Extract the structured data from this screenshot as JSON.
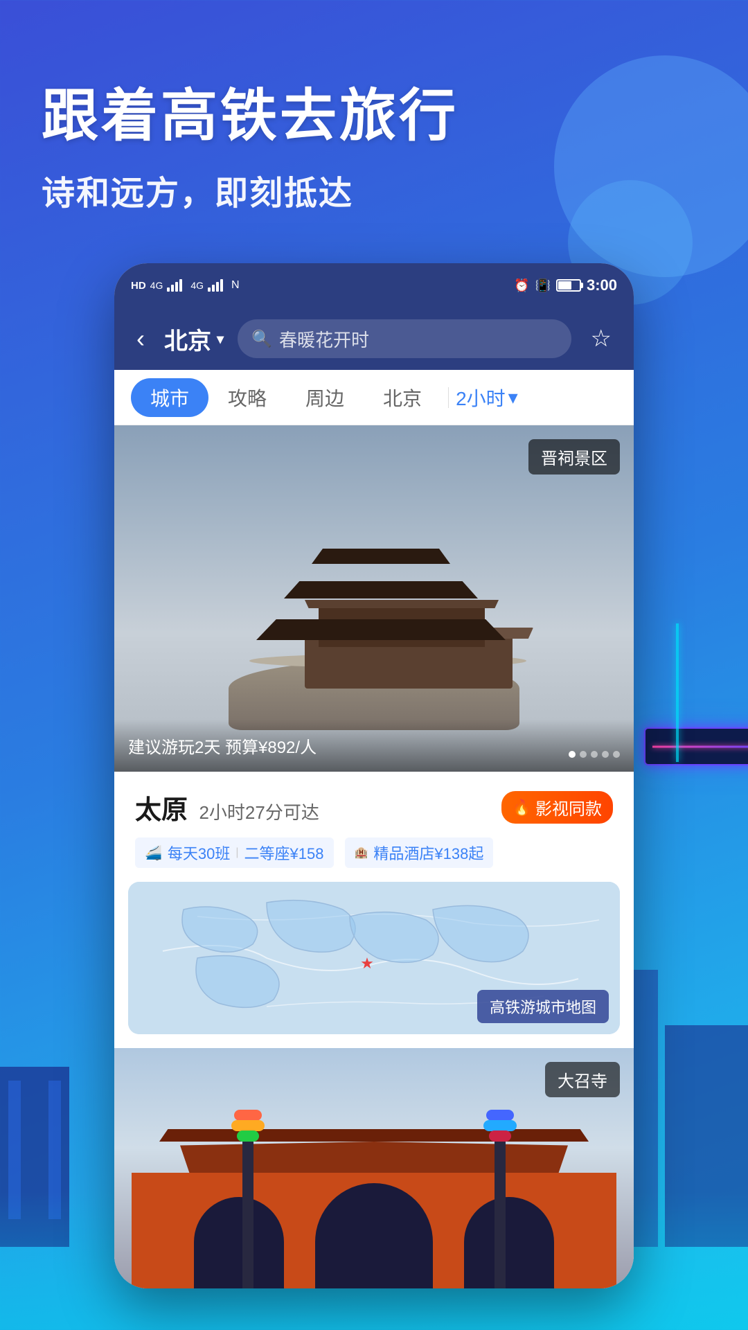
{
  "app": {
    "hero_title": "跟着高铁去旅行",
    "hero_subtitle": "诗和远方，即刻抵达"
  },
  "status_bar": {
    "time": "3:00",
    "battery": "51"
  },
  "nav": {
    "city": "北京",
    "search_placeholder": "春暖花开时",
    "back_label": "‹"
  },
  "tabs": [
    {
      "id": "city",
      "label": "城市",
      "active": true
    },
    {
      "id": "guide",
      "label": "攻略",
      "active": false
    },
    {
      "id": "nearby",
      "label": "周边",
      "active": false
    },
    {
      "id": "beijing",
      "label": "北京",
      "active": false
    },
    {
      "id": "time",
      "label": "2小时",
      "active": false
    }
  ],
  "hero_card": {
    "tag": "晋祠景区",
    "desc": "建议游玩2天  预算¥892/人"
  },
  "destination": {
    "name": "太原",
    "travel_time": "2小时27分可达",
    "badge": "影视同款",
    "transport_info": "每天30班",
    "seat_info": "二等座¥158",
    "hotel_info": "精品酒店¥138起"
  },
  "map": {
    "tag": "高铁游城市地图"
  },
  "second_card": {
    "tag": "大召寺"
  }
}
